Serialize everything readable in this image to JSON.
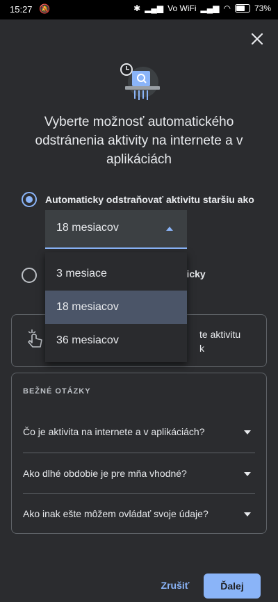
{
  "status": {
    "time": "15:27",
    "network": "Vo WiFi",
    "battery": "73%"
  },
  "dialog": {
    "headline": "Vyberte možnosť automatického odstránenia aktivity na internete a v aplikáciách",
    "option_auto_label": "Automaticky odstraňovať aktivitu staršiu ako",
    "select_value": "18 mesiacov",
    "option_manual_partial": "aticky",
    "card_partial": "te aktivitu",
    "card_partial2": "k",
    "menu_items": [
      "3 mesiace",
      "18 mesiacov",
      "36 mesiacov"
    ],
    "faq_title": "BEŽNÉ OTÁZKY",
    "faq": [
      "Čo je aktivita na internete a v aplikáciách?",
      "Ako dlhé obdobie je pre mňa vhodné?",
      "Ako inak ešte môžem ovládať svoje údaje?"
    ],
    "cancel_label": "Zrušiť",
    "next_label": "Ďalej"
  },
  "colors": {
    "accent": "#8ab4f8",
    "sheet": "#2b2c2f",
    "text": "#e8eaed"
  }
}
